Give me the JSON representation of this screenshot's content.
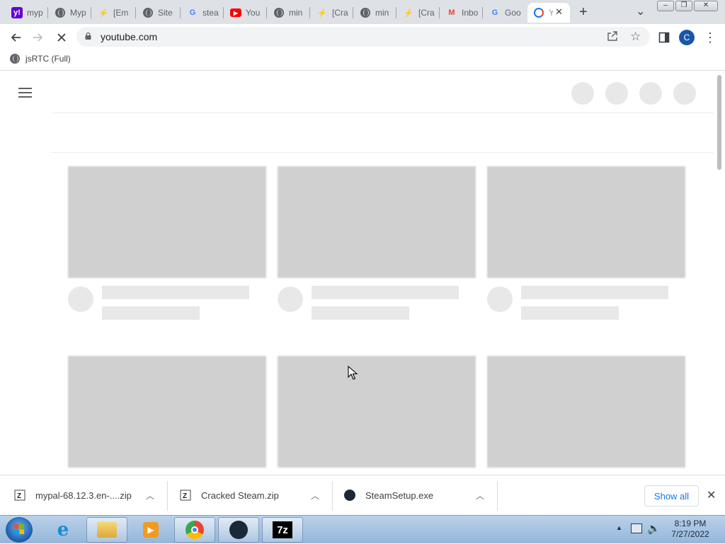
{
  "tabs": [
    {
      "icon": "yahoo-icon",
      "title": "myp",
      "color": "#6001d2"
    },
    {
      "icon": "globe-icon",
      "title": "Myp",
      "color": "#5f6368"
    },
    {
      "icon": "crack-site-icon",
      "title": "[Em",
      "color": "#3c4043"
    },
    {
      "icon": "globe-icon",
      "title": "Site",
      "color": "#5f6368"
    },
    {
      "icon": "google-icon",
      "title": "stea",
      "color": "#4285f4"
    },
    {
      "icon": "youtube-icon",
      "title": "You",
      "color": "#ff0000"
    },
    {
      "icon": "globe-icon",
      "title": "min",
      "color": "#5f6368"
    },
    {
      "icon": "crack-site-icon",
      "title": "[Cra",
      "color": "#3c4043"
    },
    {
      "icon": "globe-icon",
      "title": "min",
      "color": "#5f6368"
    },
    {
      "icon": "crack-site-icon",
      "title": "[Cra",
      "color": "#3c4043"
    },
    {
      "icon": "gmail-icon",
      "title": "Inbo",
      "color": "#ea4335"
    },
    {
      "icon": "google-icon",
      "title": "Goo",
      "color": "#4285f4"
    },
    {
      "icon": "youtube-loading-icon",
      "title": "Y",
      "color": "#1a73e8"
    }
  ],
  "window": {
    "minimize": "–",
    "maximize": "❐",
    "close": "✕",
    "new_tab": "+",
    "tab_search": "⌄"
  },
  "address": {
    "url": "youtube.com"
  },
  "profile": {
    "initial": "C"
  },
  "bookmarks": [
    {
      "label": "jsRTC (Full)"
    }
  ],
  "downloads": [
    {
      "name": "mypal-68.12.3.en-....zip",
      "icon": "zip-archive-icon"
    },
    {
      "name": "Cracked Steam.zip",
      "icon": "zip-archive-icon"
    },
    {
      "name": "SteamSetup.exe",
      "icon": "steam-icon"
    }
  ],
  "downloads_bar": {
    "show_all": "Show all"
  },
  "taskbar": {
    "apps": [
      "internet-explorer-icon",
      "windows-explorer-icon",
      "media-player-icon",
      "chrome-icon",
      "steam-icon",
      "7zip-icon"
    ],
    "seven_zip_label": "7z"
  },
  "clock": {
    "time": "8:19 PM",
    "date": "7/27/2022"
  }
}
